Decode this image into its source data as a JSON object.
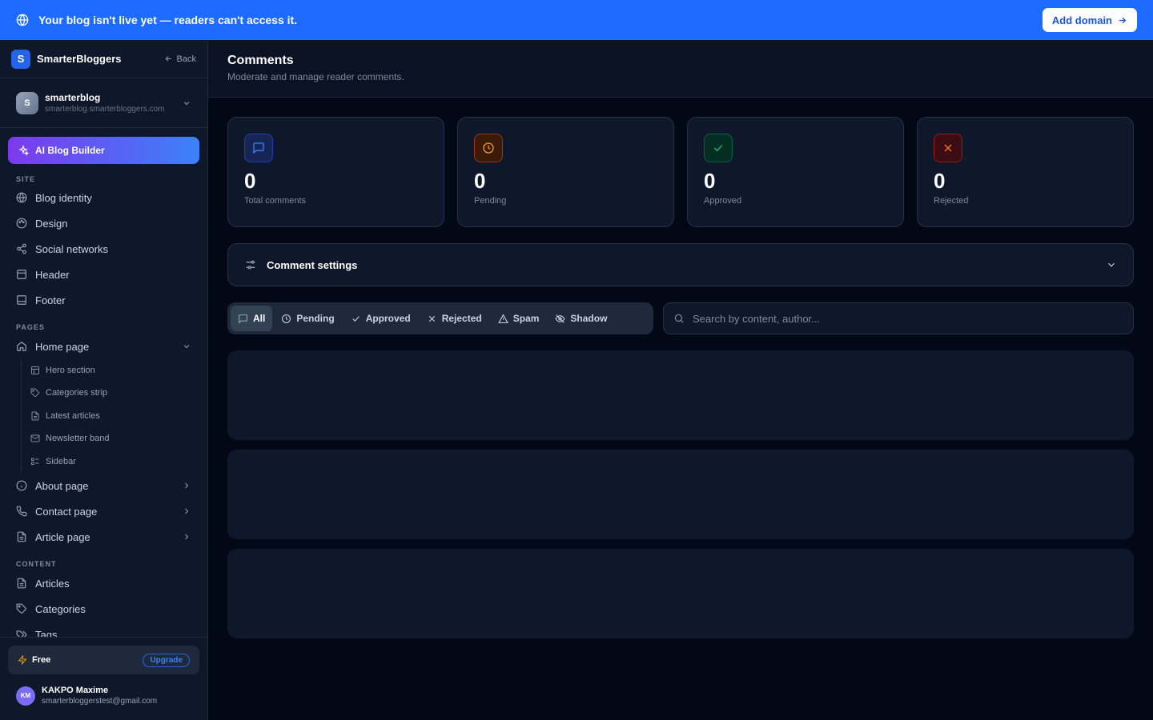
{
  "banner": {
    "message": "Your blog isn't live yet — readers can't access it.",
    "button": "Add domain",
    "color": "#1d6cff"
  },
  "brand": {
    "logo": "S",
    "name": "SmarterBloggers",
    "back": "Back"
  },
  "blog": {
    "avatar": "S",
    "name": "smarterblog",
    "domain": "smarterblog.smarterbloggers.com"
  },
  "ai_builder": "AI Blog Builder",
  "sections": {
    "site": "SITE",
    "pages": "PAGES",
    "content": "CONTENT"
  },
  "site_items": [
    {
      "label": "Blog identity",
      "icon": "globe-icon"
    },
    {
      "label": "Design",
      "icon": "palette-icon"
    },
    {
      "label": "Social networks",
      "icon": "share-icon"
    },
    {
      "label": "Header",
      "icon": "layout-icon"
    },
    {
      "label": "Footer",
      "icon": "layout-icon"
    }
  ],
  "pages_items": [
    {
      "label": "Home page",
      "icon": "home-icon"
    },
    {
      "label": "About page",
      "icon": "info-icon"
    },
    {
      "label": "Contact page",
      "icon": "phone-icon"
    },
    {
      "label": "Article page",
      "icon": "file-icon"
    }
  ],
  "home_sub": [
    {
      "label": "Hero section",
      "icon": "layout-icon"
    },
    {
      "label": "Categories strip",
      "icon": "tag-icon"
    },
    {
      "label": "Latest articles",
      "icon": "file-icon"
    },
    {
      "label": "Newsletter band",
      "icon": "mail-icon"
    },
    {
      "label": "Sidebar",
      "icon": "list-icon"
    }
  ],
  "content_items": [
    {
      "label": "Articles",
      "icon": "file-icon"
    },
    {
      "label": "Categories",
      "icon": "tag-icon"
    },
    {
      "label": "Tags",
      "icon": "tags-icon"
    }
  ],
  "plan": {
    "name": "Free",
    "upgrade": "Upgrade"
  },
  "user": {
    "initials": "KM",
    "name": "KAKPO Maxime",
    "email": "smarterbloggerstest@gmail.com"
  },
  "page": {
    "title": "Comments",
    "subtitle": "Moderate and manage reader comments."
  },
  "stats": [
    {
      "value": "0",
      "label": "Total comments",
      "color": "#3b82f6"
    },
    {
      "value": "0",
      "label": "Pending",
      "color": "#f59e0b"
    },
    {
      "value": "0",
      "label": "Approved",
      "color": "#10b981"
    },
    {
      "value": "0",
      "label": "Rejected",
      "color": "#ef4444"
    }
  ],
  "settings": {
    "title": "Comment settings"
  },
  "filters": [
    "All",
    "Pending",
    "Approved",
    "Rejected",
    "Spam",
    "Shadow"
  ],
  "search": {
    "placeholder": "Search by content, author..."
  }
}
